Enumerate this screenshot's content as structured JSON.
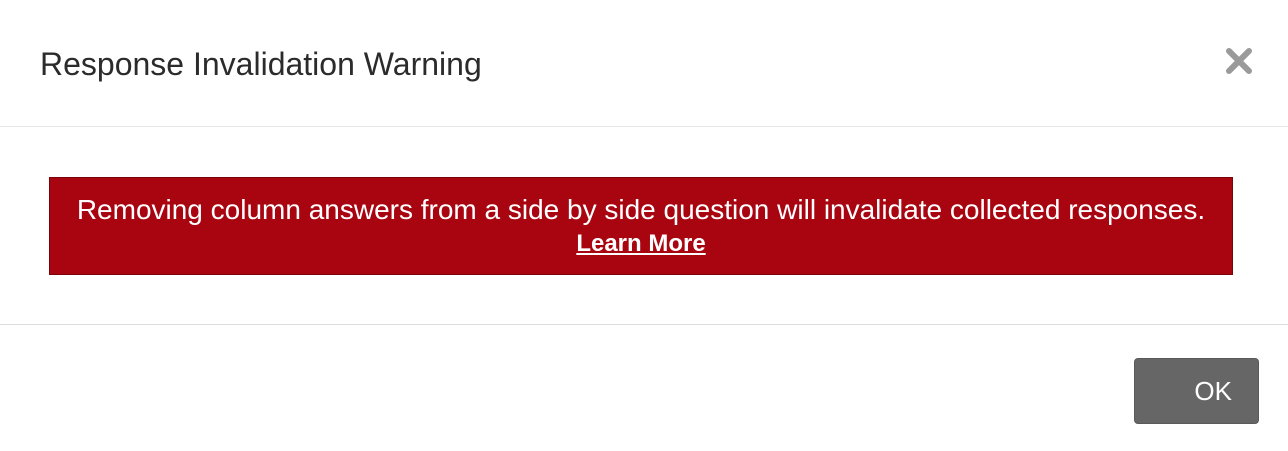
{
  "dialog": {
    "title": "Response Invalidation Warning",
    "close_icon": "close-icon"
  },
  "warning": {
    "message": "Removing column answers from a side by side question will invalidate collected responses.",
    "link_label": "Learn More",
    "background_color": "#a80511"
  },
  "footer": {
    "ok_label": "OK",
    "ok_color": "#666666"
  }
}
